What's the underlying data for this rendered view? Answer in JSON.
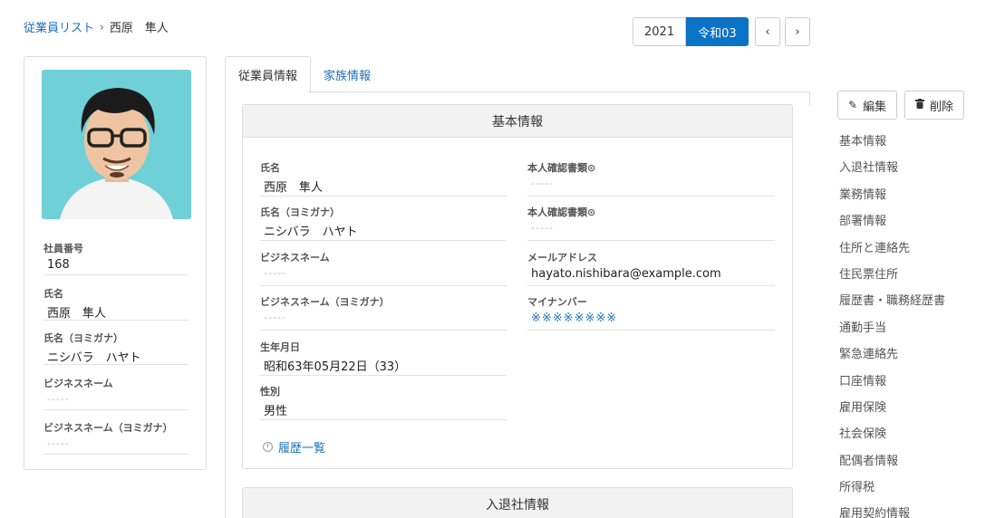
{
  "breadcrumb": {
    "parent": "従業員リスト",
    "separator": "›",
    "current": "西原　隼人"
  },
  "year": {
    "western": "2021",
    "japanese": "令和03"
  },
  "nav": {
    "prev": "‹",
    "next": "›"
  },
  "profile": {
    "fields": [
      {
        "label": "社員番号",
        "value": "168"
      },
      {
        "label": "氏名",
        "value": "西原　隼人"
      },
      {
        "label": "氏名（ヨミガナ）",
        "value": "ニシバラ　ハヤト"
      },
      {
        "label": "ビジネスネーム",
        "value": "-----"
      },
      {
        "label": "ビジネスネーム（ヨミガナ）",
        "value": "-----"
      }
    ]
  },
  "tabs": [
    {
      "label": "従業員情報"
    },
    {
      "label": "家族情報"
    }
  ],
  "basic": {
    "title": "基本情報",
    "left": [
      {
        "label": "氏名",
        "value": "西原　隼人"
      },
      {
        "label": "氏名（ヨミガナ）",
        "value": "ニシバラ　ハヤト"
      },
      {
        "label": "ビジネスネーム",
        "value": "-----"
      },
      {
        "label": "ビジネスネーム（ヨミガナ）",
        "value": "-----"
      },
      {
        "label": "生年月日",
        "value": "昭和63年05月22日（33）"
      },
      {
        "label": "性別",
        "value": "男性"
      }
    ],
    "right": [
      {
        "label": "本人確認書類⊙",
        "value": "-----"
      },
      {
        "label": "本人確認書類⊙",
        "value": "-----"
      },
      {
        "label": "メールアドレス",
        "value": "hayato.nishibara@example.com"
      },
      {
        "label": "マイナンバー",
        "value": "※※※※※※※※"
      }
    ],
    "history_link": "履歴一覧"
  },
  "next_section": {
    "title": "入退社情報"
  },
  "actions": {
    "edit": "編集",
    "delete": "削除"
  },
  "side_nav": [
    "基本情報",
    "入退社情報",
    "業務情報",
    "部署情報",
    "住所と連絡先",
    "住民票住所",
    "履歴書・職務経歴書",
    "通勤手当",
    "緊急連絡先",
    "口座情報",
    "雇用保険",
    "社会保険",
    "配偶者情報",
    "所得税",
    "雇用契約情報"
  ],
  "colors": {
    "accent": "#0a73c6",
    "link": "#1e6fbf",
    "photo_bg": "#6fd0d8"
  }
}
